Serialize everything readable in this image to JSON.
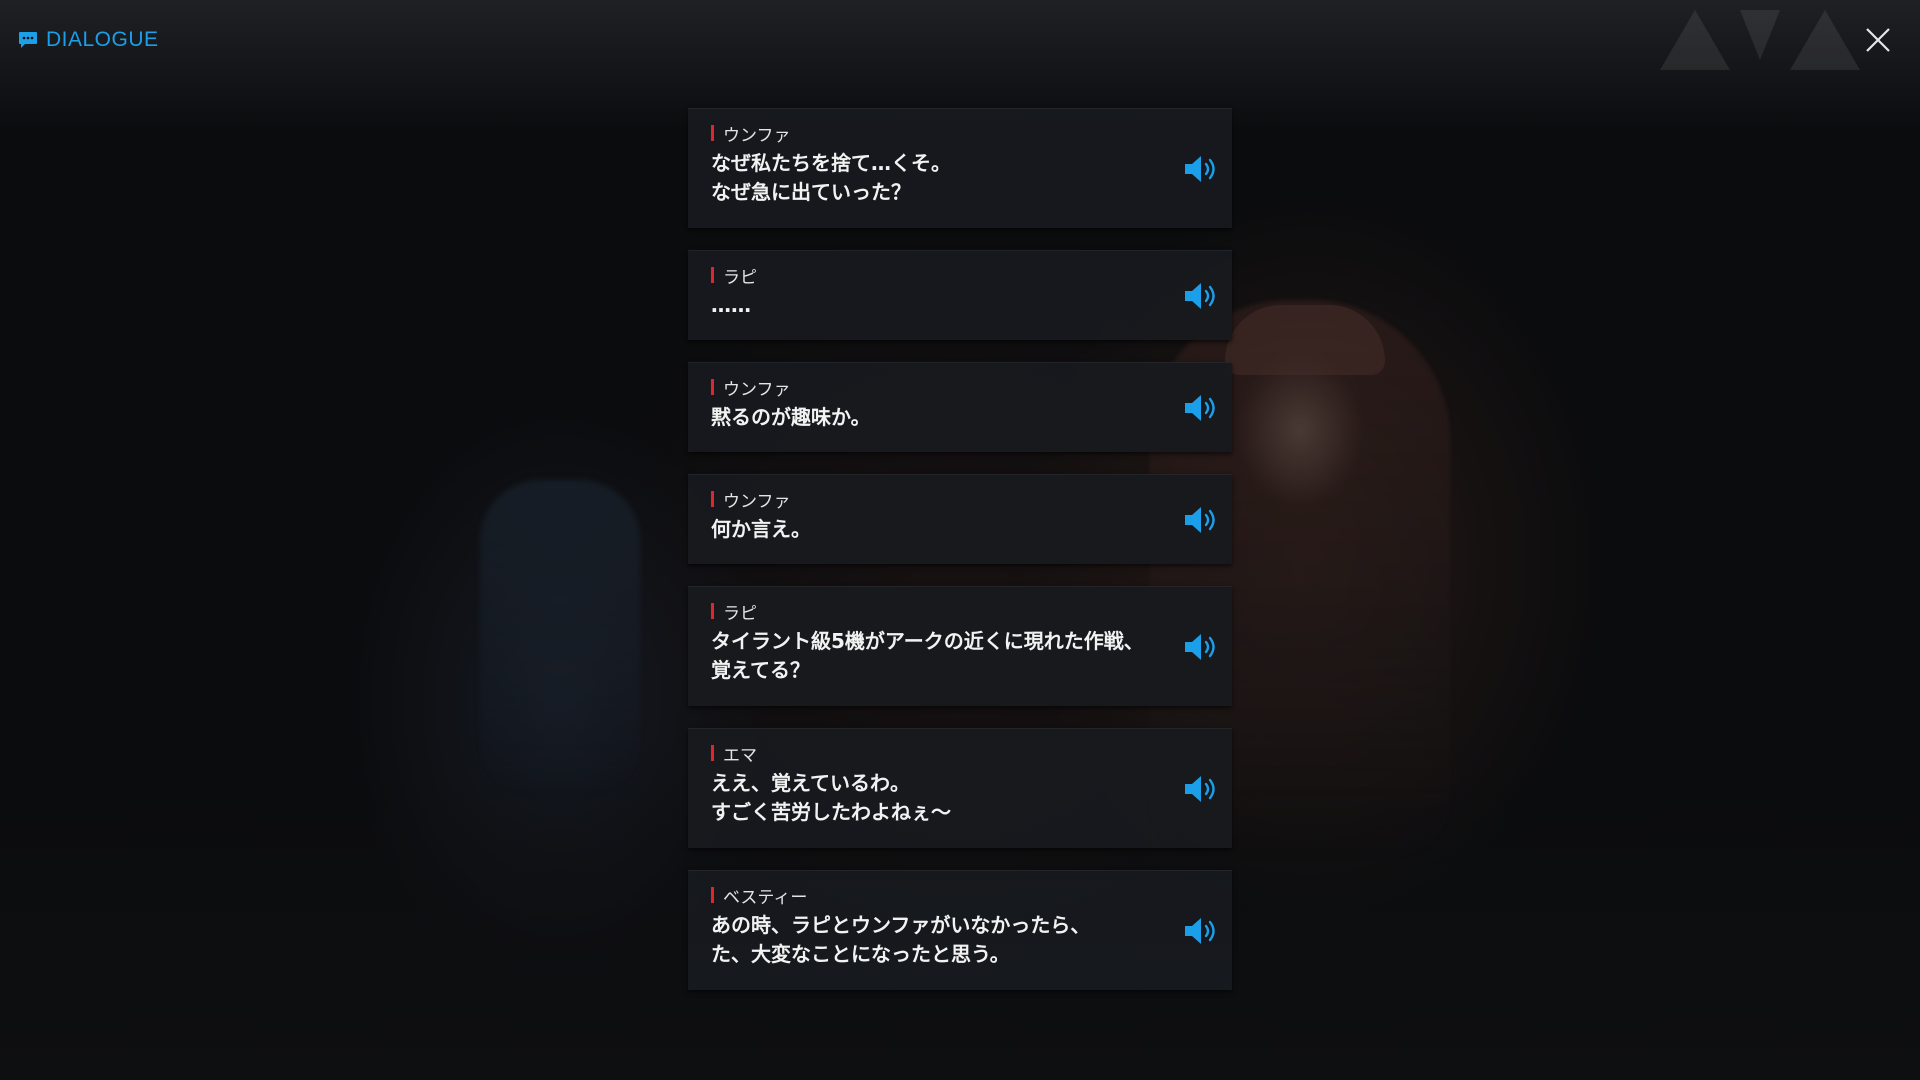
{
  "header": {
    "title": "DIALOGUE",
    "icon": "chat-bubble-icon",
    "accent_color": "#1a9fe8"
  },
  "close_icon": "close-icon",
  "speaker_marker_color": "#e0262c",
  "dialogue": [
    {
      "speaker": "ウンファ",
      "text": "なぜ私たちを捨て…くそ。\nなぜ急に出ていった？"
    },
    {
      "speaker": "ラピ",
      "text": "……"
    },
    {
      "speaker": "ウンファ",
      "text": "黙るのが趣味か。"
    },
    {
      "speaker": "ウンファ",
      "text": "何か言え。"
    },
    {
      "speaker": "ラピ",
      "text": "タイラント級5機がアークの近くに現れた作戦、\n覚えてる？"
    },
    {
      "speaker": "エマ",
      "text": "ええ、覚えているわ。\nすごく苦労したわよねぇ～"
    },
    {
      "speaker": "ベスティー",
      "text": "あの時、ラピとウンファがいなかったら、\nた、大変なことになったと思う。"
    }
  ]
}
